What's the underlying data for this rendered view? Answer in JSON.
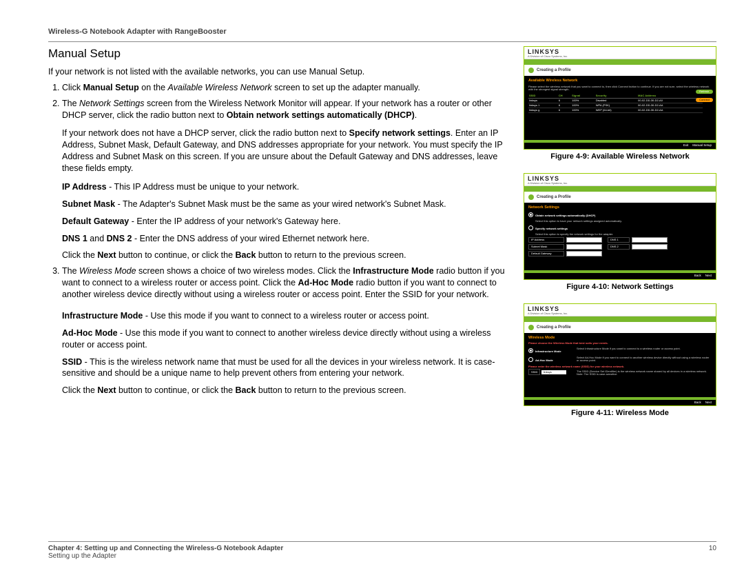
{
  "header": {
    "product": "Wireless-G Notebook Adapter with RangeBooster"
  },
  "title": "Manual Setup",
  "intro": "If your network is not listed with the available networks, you can use Manual Setup.",
  "steps": {
    "s1_a": "Click ",
    "s1_b": "Manual Setup",
    "s1_c": " on the ",
    "s1_d": "Available Wireless Network",
    "s1_e": " screen to set up the adapter manually.",
    "s2_a": "The ",
    "s2_b": "Network Settings",
    "s2_c": " screen from the Wireless Network Monitor will appear. If your network has a router or other DHCP server, click the radio button next to ",
    "s2_d": "Obtain network settings automatically (DHCP)",
    "s2_e": ".",
    "s2p2_a": "If your network does not have a DHCP server, click the radio button next to ",
    "s2p2_b": "Specify network settings",
    "s2p2_c": ". Enter an IP Address, Subnet Mask, Default Gateway, and DNS addresses appropriate for your network. You must specify the IP Address and Subnet Mask on this screen. If you are unsure about the Default Gateway and DNS addresses, leave these fields empty.",
    "ip_a": "IP Address",
    "ip_b": " - This IP Address must be unique to your network.",
    "sm_a": "Subnet Mask",
    "sm_b": " - The Adapter's Subnet Mask must be the same as your wired network's Subnet Mask.",
    "dg_a": "Default Gateway",
    "dg_b": " - Enter the IP address of your network's Gateway here.",
    "dns_a": "DNS 1",
    "dns_mid": " and ",
    "dns_b": "DNS 2",
    "dns_c": " - Enter the DNS address of your wired Ethernet network here.",
    "nav1_a": "Click the ",
    "nav1_b": "Next",
    "nav1_c": " button to continue, or click the ",
    "nav1_d": "Back",
    "nav1_e": " button to return to the previous screen.",
    "s3_a": "The ",
    "s3_b": "Wireless Mode",
    "s3_c": " screen shows a choice of two wireless modes. Click the ",
    "s3_d": "Infrastructure Mode",
    "s3_e": " radio button if you want to connect to a wireless router or access point. Click the ",
    "s3_f": "Ad-Hoc Mode",
    "s3_g": " radio button if you want to connect to another wireless device directly without using a wireless router or access point. Enter the SSID for your network.",
    "im_a": "Infrastructure Mode",
    "im_b": " - Use this mode if you want to connect to a wireless router or access point.",
    "ah_a": "Ad-Hoc Mode",
    "ah_b": " - Use this mode if you want to connect to another wireless device directly without using a wireless router or access point.",
    "ssid_a": "SSID",
    "ssid_b": " - This is the wireless network name that must be used for all the devices in your wireless network. It is case- sensitive and should be a unique name to help prevent others from entering your network."
  },
  "figures": {
    "f9": "Figure 4-9: Available Wireless Network",
    "f10": "Figure 4-10: Network Settings",
    "f11": "Figure 4-11: Wireless Mode"
  },
  "shot_common": {
    "brand": "LINKSYS",
    "brand_sub": "A Division of Cisco Systems, Inc.",
    "creating": "Creating a Profile",
    "back": "Back",
    "next": "Next",
    "exit": "Exit",
    "manual": "Manual Setup"
  },
  "shot1": {
    "title": "Available Wireless Network",
    "desc": "Please select the wireless network that you want to connect to, then click Connect button to continue. If you are not sure, select the wireless network with the strongest signal strength.",
    "refresh": "Refresh",
    "connect": "Connect",
    "cols": {
      "ssid": "SSID",
      "ch": "CH",
      "signal": "Signal",
      "security": "Security",
      "mac": "MAC Address"
    },
    "rows": [
      {
        "ssid": "linksys",
        "ch": "6",
        "sig": "100%",
        "sec": "Disabled",
        "mac": "00-02-DD-30-D2-A0"
      },
      {
        "ssid": "linksys 1",
        "ch": "6",
        "sig": "100%",
        "sec": "WPA (PSK)",
        "mac": "00-02-DD-30-D2-AA"
      },
      {
        "ssid": "linksys g",
        "ch": "6",
        "sig": "100%",
        "sec": "WEP (64-bit)",
        "mac": "00-02-DD-30-D2-AA"
      }
    ]
  },
  "shot2": {
    "title": "Network Settings",
    "opt1": "Obtain network settings automatically (DHCP)",
    "opt1_desc": "Select this option to have your network settings assigned automatically.",
    "opt2": "Specify network settings",
    "opt2_desc": "Select this option to specify the network settings for the adapter.",
    "ip": "IP Address",
    "sm": "Subnet Mask",
    "dg": "Default Gateway",
    "dns1": "DNS 1",
    "dns2": "DNS 2"
  },
  "shot3": {
    "title": "Wireless Mode",
    "heading": "Please choose the Wireless Mode that best suits your needs.",
    "inf": "Infrastructure Mode",
    "inf_desc": "Select Infrastructure Mode if you want to connect to a wireless router or access point.",
    "adhoc": "Ad-Hoc Mode",
    "adhoc_desc": "Select Ad-Hoc Mode if you want to connect to another wireless device directly without using a wireless router or access point.",
    "ssid_label": "SSID",
    "ssid_value": "linksys",
    "ssid_desc": "The SSID (Service Set IDentifier) is the wireless network name shared by all devices in a wireless network. Note: The SSID is case-sensitive.",
    "bottom_note": "Please enter the wireless network name (SSID) for your wireless network."
  },
  "footer": {
    "chapter": "Chapter 4: Setting up and Connecting the Wireless-G Notebook Adapter",
    "section": "Setting up the Adapter",
    "page": "10"
  }
}
